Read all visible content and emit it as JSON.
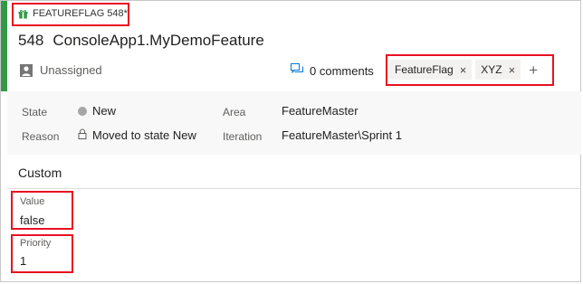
{
  "header": {
    "work_item_type": "FEATUREFLAG 548*",
    "id": "548",
    "title": "ConsoleApp1.MyDemoFeature",
    "assigned_to": "Unassigned",
    "comments": "0 comments",
    "tags": [
      "FeatureFlag",
      "XYZ"
    ],
    "add_tag_glyph": "+",
    "remove_tag_glyph": "×",
    "accent_color": "#339947",
    "highlight_color": "#e81123"
  },
  "details": {
    "state_label": "State",
    "state_value": "New",
    "reason_label": "Reason",
    "reason_value": "Moved to state New",
    "area_label": "Area",
    "area_value": "FeatureMaster",
    "iteration_label": "Iteration",
    "iteration_value": "FeatureMaster\\Sprint 1"
  },
  "custom": {
    "section_title": "Custom",
    "fields": [
      {
        "label": "Value",
        "value": "false"
      },
      {
        "label": "Priority",
        "value": "1"
      }
    ]
  },
  "icons": [
    "gift-icon",
    "person-icon",
    "comment-icon",
    "lock-icon",
    "close-icon",
    "add-icon"
  ]
}
